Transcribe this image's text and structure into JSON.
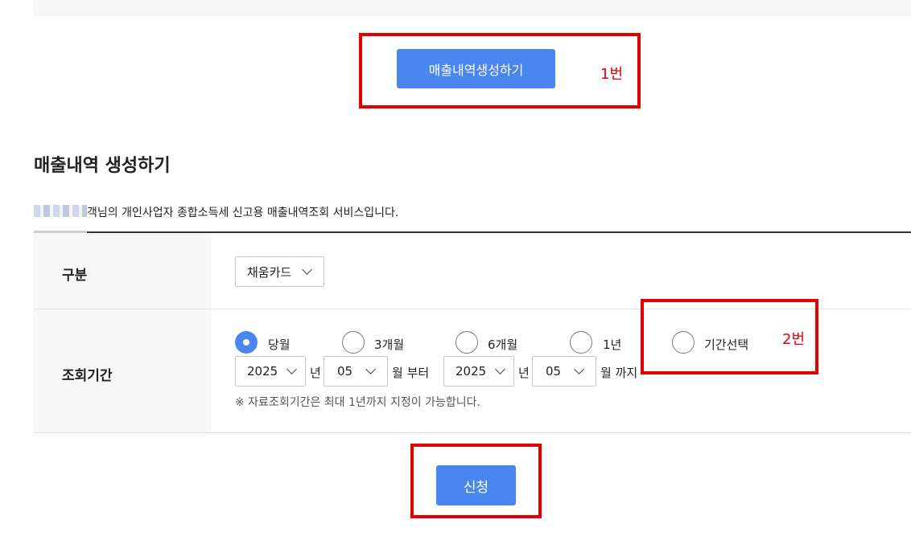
{
  "top_button": {
    "label": "매출내역생성하기"
  },
  "annotations": {
    "label_1": "1번",
    "label_2": "2번"
  },
  "section": {
    "title": "매출내역 생성하기",
    "notice": "객님의 개인사업자 종합소득세 신고용 매출내역조회 서비스입니다."
  },
  "form": {
    "type_row": {
      "label": "구분",
      "selected": "채움카드"
    },
    "period_row": {
      "label": "조회기간",
      "options": [
        "당월",
        "3개월",
        "6개월",
        "1년",
        "기간선택"
      ],
      "selected_option": "당월",
      "start_year": "2025",
      "year_unit_1": "년",
      "start_month": "05",
      "from_text": "월 부터",
      "end_year": "2025",
      "year_unit_2": "년",
      "end_month": "05",
      "until_text": "월 까지",
      "note": "※ 자료조회기간은 최대 1년까지 지정이 가능합니다."
    }
  },
  "submit_button": {
    "label": "신청"
  },
  "colors": {
    "accent": "#4a86f0",
    "annotation": "#e60000"
  }
}
